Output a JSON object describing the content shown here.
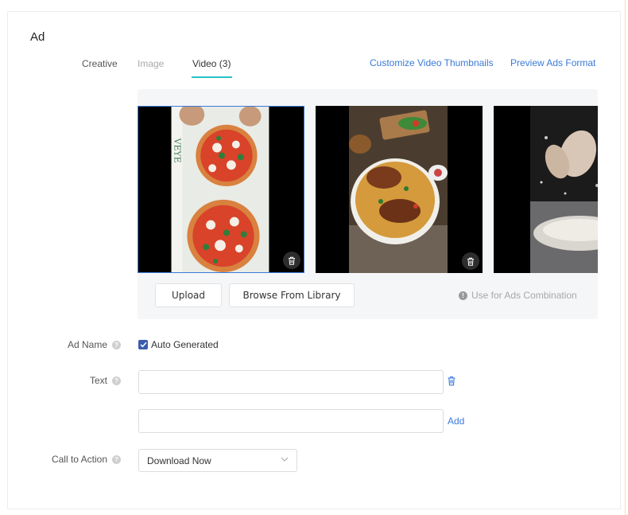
{
  "section": {
    "title": "Ad"
  },
  "creative": {
    "label": "Creative",
    "tabs": [
      {
        "label": "Image",
        "active": false
      },
      {
        "label": "Video (3)",
        "active": true
      }
    ],
    "links": {
      "customize": "Customize Video Thumbnails",
      "preview": "Preview Ads Format"
    }
  },
  "media": {
    "videos": [
      {
        "subject": "pizza",
        "selected": true
      },
      {
        "subject": "rice-dish",
        "selected": false
      },
      {
        "subject": "dough",
        "selected": false
      }
    ],
    "upload_label": "Upload",
    "browse_label": "Browse From Library",
    "combination_label": "Use for Ads Combination"
  },
  "form": {
    "ad_name": {
      "label": "Ad Name",
      "checkbox_label": "Auto Generated",
      "checked": true
    },
    "text": {
      "label": "Text",
      "values": [
        "",
        ""
      ],
      "add_label": "Add"
    },
    "cta": {
      "label": "Call to Action",
      "value": "Download Now"
    }
  },
  "colors": {
    "accent": "#27c2c9",
    "link": "#3b7ad9",
    "checkbox": "#3b5cad"
  }
}
